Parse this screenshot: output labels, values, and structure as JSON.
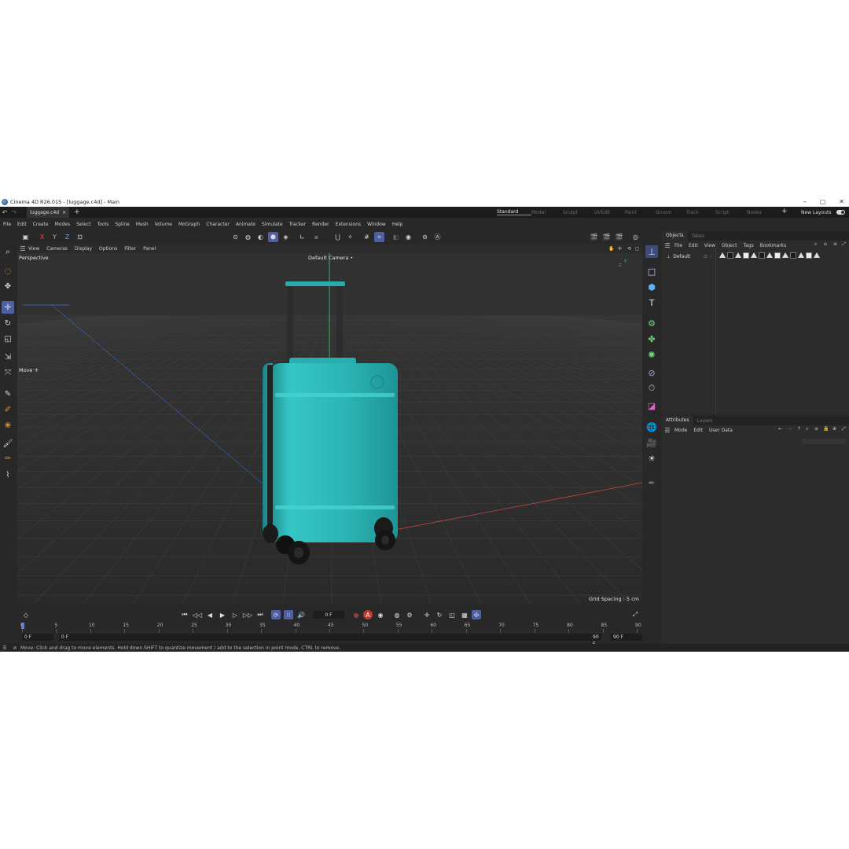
{
  "window": {
    "title": "Cinema 4D R26.015 - [luggage.c4d] - Main",
    "minimize": "–",
    "maximize": "▢",
    "close": "✕"
  },
  "doc_tab": {
    "label": "luggage.c4d",
    "close": "×"
  },
  "layouts": {
    "items": [
      "Standard",
      "Model",
      "Sculpt",
      "UVEdit",
      "Paint",
      "Groom",
      "Track",
      "Script",
      "Nodes"
    ],
    "active": "Standard",
    "new_layouts": "New Layouts"
  },
  "menu": [
    "File",
    "Edit",
    "Create",
    "Modes",
    "Select",
    "Tools",
    "Spline",
    "Mesh",
    "Volume",
    "MoGraph",
    "Character",
    "Animate",
    "Simulate",
    "Tracker",
    "Render",
    "Extensions",
    "Window",
    "Help"
  ],
  "axis_toolbar": {
    "x": "X",
    "y": "Y",
    "z": "Z"
  },
  "viewport_menu": [
    "View",
    "Cameras",
    "Display",
    "Options",
    "Filter",
    "Panel"
  ],
  "viewport": {
    "projection": "Perspective",
    "camera": "Default Camera",
    "camera_suffix": "•",
    "tool_label": "Move",
    "tool_suffix": "✛",
    "grid_spacing": "Grid Spacing : 5 cm",
    "axis_y": "Y",
    "axis_z": "Z"
  },
  "objects_panel": {
    "tabs": [
      "Objects",
      "Takes"
    ],
    "menu": [
      "File",
      "Edit",
      "View",
      "Object",
      "Tags",
      "Bookmarks"
    ],
    "object_name": "Default"
  },
  "attributes_panel": {
    "tabs": [
      "Attributes",
      "Layers"
    ],
    "menu": [
      "Mode",
      "Edit",
      "User Data"
    ]
  },
  "timeline": {
    "current_frame": "0 F",
    "start_field": "0 F",
    "start_field2": "0 F",
    "end_field": "90 F",
    "end_field2": "90 F",
    "ruler": [
      "0",
      "5",
      "10",
      "15",
      "20",
      "25",
      "30",
      "35",
      "40",
      "45",
      "50",
      "55",
      "60",
      "65",
      "70",
      "75",
      "80",
      "85",
      "90"
    ]
  },
  "status": "Move: Click and drag to move elements. Hold down SHIFT to quantize movement / add to the selection in point mode, CTRL to remove.",
  "colors": {
    "accent": "#4f5fa6",
    "luggage": "#2ab3b3",
    "axis_x": "#c0392b",
    "axis_y": "#2ecc71",
    "axis_z": "#3b6fd6"
  }
}
